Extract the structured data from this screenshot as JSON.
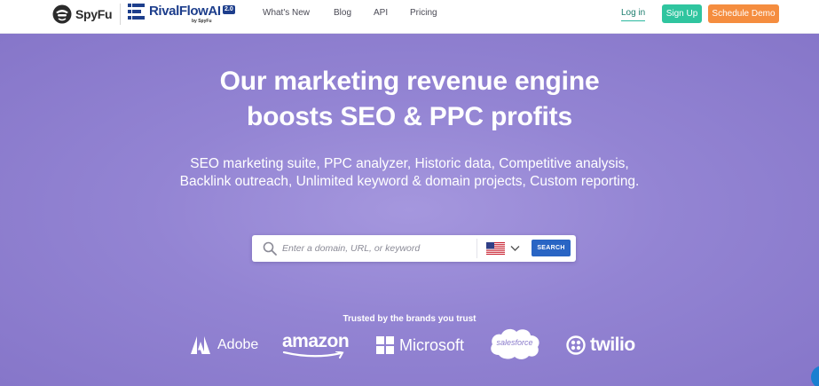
{
  "header": {
    "spyfu_logo_text": "SpyFu",
    "rivalflow_logo_text": "RivalFlowAI",
    "rivalflow_badge": "2.0",
    "rivalflow_by": "by SpyFu",
    "nav": {
      "whats_new": "What's New",
      "blog": "Blog",
      "api": "API",
      "pricing": "Pricing"
    },
    "login": "Log in",
    "signup": "Sign Up",
    "schedule_demo": "Schedule Demo"
  },
  "hero": {
    "title_line1": "Our marketing revenue engine",
    "title_line2": "boosts SEO & PPC profits",
    "subtitle": "SEO marketing suite, PPC analyzer, Historic data, Competitive analysis, Backlink outreach, Unlimited keyword & domain projects, Custom reporting."
  },
  "search": {
    "placeholder": "Enter a domain, URL, or keyword",
    "value": "",
    "country_icon": "us-flag-icon",
    "button": "SEARCH"
  },
  "trusted": {
    "heading": "Trusted by the brands you trust",
    "brands": {
      "adobe": "Adobe",
      "amazon": "amazon",
      "microsoft": "Microsoft",
      "salesforce": "salesforce",
      "twilio": "twilio"
    }
  },
  "colors": {
    "hero_bg": "#9384d3",
    "signup": "#2fc59f",
    "schedule_demo": "#f58d3f",
    "search_button": "#2965c4",
    "rivalflow_blue": "#1d3e8c"
  }
}
